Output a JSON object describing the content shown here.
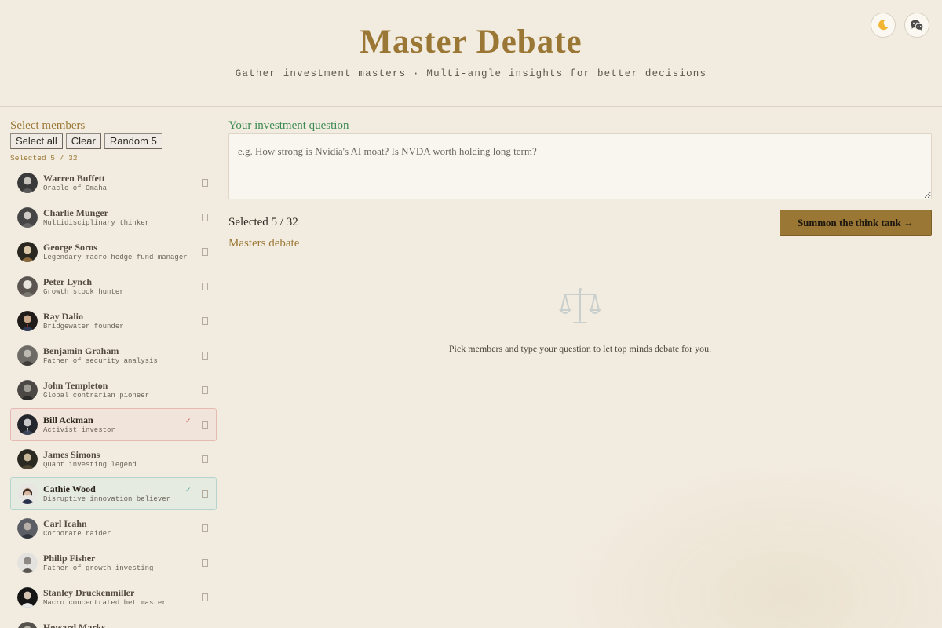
{
  "header": {
    "title": "Master Debate",
    "subtitle": "Gather investment masters · Multi-angle insights for better decisions",
    "theme_toggle_icon": "moon-icon",
    "share_icon": "wechat-icon"
  },
  "sidebar": {
    "label": "Select members",
    "buttons": {
      "select_all": "Select all",
      "clear": "Clear",
      "random": "Random 5"
    },
    "selected_text": "Selected 5 / 32",
    "members": [
      {
        "name": "Warren Buffett",
        "desc": "Oracle of Omaha",
        "check": ""
      },
      {
        "name": "Charlie Munger",
        "desc": "Multidisciplinary thinker",
        "check": ""
      },
      {
        "name": "George Soros",
        "desc": "Legendary macro hedge fund manager",
        "check": ""
      },
      {
        "name": "Peter Lynch",
        "desc": "Growth stock hunter",
        "check": ""
      },
      {
        "name": "Ray Dalio",
        "desc": "Bridgewater founder",
        "check": ""
      },
      {
        "name": "Benjamin Graham",
        "desc": "Father of security analysis",
        "check": ""
      },
      {
        "name": "John Templeton",
        "desc": "Global contrarian pioneer",
        "check": ""
      },
      {
        "name": "Bill Ackman",
        "desc": "Activist investor",
        "check": "✓"
      },
      {
        "name": "James Simons",
        "desc": "Quant investing legend",
        "check": ""
      },
      {
        "name": "Cathie Wood",
        "desc": "Disruptive innovation believer",
        "check": "✓"
      },
      {
        "name": "Carl Icahn",
        "desc": "Corporate raider",
        "check": ""
      },
      {
        "name": "Philip Fisher",
        "desc": "Father of growth investing",
        "check": ""
      },
      {
        "name": "Stanley Druckenmiller",
        "desc": "Macro concentrated bet master",
        "check": ""
      },
      {
        "name": "Howard Marks",
        "desc": "",
        "check": ""
      }
    ]
  },
  "main": {
    "question_label": "Your investment question",
    "question_placeholder": "e.g. How strong is Nvidia's AI moat? Is NVDA worth holding long term?",
    "question_value": "",
    "selected_text": "Selected 5 / 32",
    "summon_label": "Summon the think tank →",
    "debate_label": "Masters debate",
    "empty_icon": "scale-icon",
    "empty_text": "Pick members and type your question to let top minds debate for you."
  },
  "colors": {
    "accent_gold": "#9a7734",
    "question_green": "#3b8a52",
    "selected_red": "#e6b9b3",
    "selected_teal": "#b5d4cd",
    "background": "#f2ece0"
  }
}
